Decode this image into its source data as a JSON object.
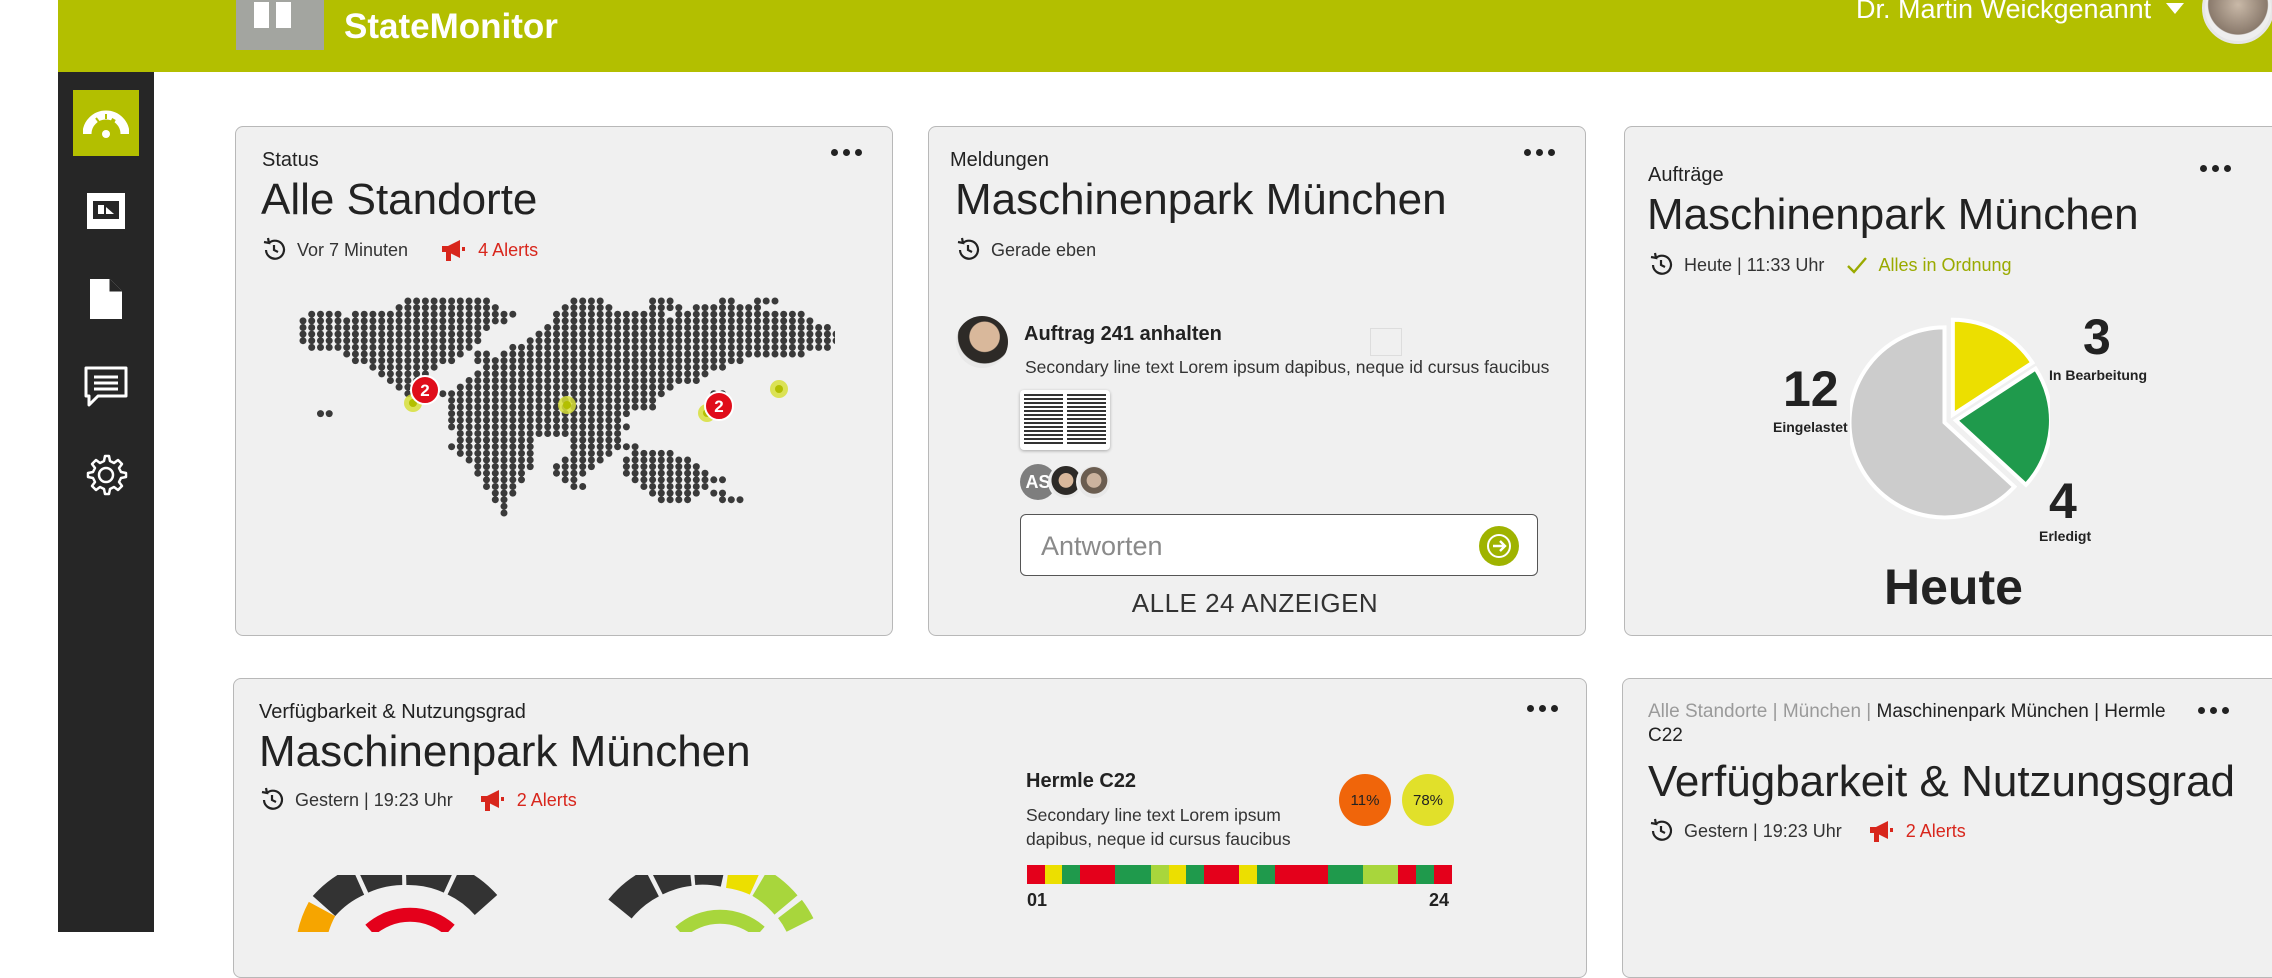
{
  "header": {
    "app_title": "StateMonitor",
    "user_name": "Dr. Martin Weickgenannt",
    "brand_color": "#b3bf00"
  },
  "sidebar": {
    "items": [
      {
        "icon": "dashboard-gauge-icon",
        "active": true
      },
      {
        "icon": "machine-icon",
        "active": false
      },
      {
        "icon": "document-icon",
        "active": false
      },
      {
        "icon": "message-icon",
        "active": false
      },
      {
        "icon": "gear-icon",
        "active": false
      }
    ]
  },
  "status_card": {
    "eyebrow": "Status",
    "title": "Alle Standorte",
    "updated": "Vor 7 Minuten",
    "alerts": "4 Alerts",
    "markers": [
      {
        "count": "2",
        "region": "north-america"
      },
      {
        "count": "2",
        "region": "asia"
      }
    ]
  },
  "messages_card": {
    "eyebrow": "Meldungen",
    "title": "Maschinenpark München",
    "updated": "Gerade eben",
    "message": {
      "title": "Auftrag 241 anhalten",
      "text": "Secondary line text Lorem ipsum dapibus, neque id cursus faucibus"
    },
    "participant_initials": "AS",
    "reply_placeholder": "Antworten",
    "show_all": "ALLE 24 ANZEIGEN"
  },
  "orders_card": {
    "eyebrow": "Aufträge",
    "title": "Maschinenpark München",
    "updated": "Heute | 11:33 Uhr",
    "status_ok": "Alles in Ordnung",
    "period": "Heute",
    "segments": [
      {
        "label": "Eingelastet",
        "value": 12,
        "color": "#cccccc"
      },
      {
        "label": "In Bearbeitung",
        "value": 3,
        "color": "#ecdf00"
      },
      {
        "label": "Erledigt",
        "value": 4,
        "color": "#1f9a4c"
      }
    ],
    "value_labels": [
      "12",
      "3",
      "4"
    ]
  },
  "availability_card": {
    "eyebrow": "Verfügbarkeit & Nutzungsgrad",
    "title": "Maschinenpark München",
    "updated": "Gestern | 19:23 Uhr",
    "alerts": "2 Alerts",
    "machine": {
      "name": "Hermle C22",
      "text": "Secondary line text Lorem ipsum dapibus, neque id cursus faucibus",
      "kpi_a": "11%",
      "kpi_b": "78%",
      "kpi_a_color": "#f0650a",
      "kpi_b_color": "#e1e02a",
      "hours_start": "01",
      "hours_end": "24",
      "hour_colors": [
        "#e4001b",
        "#ecdf00",
        "#1f9a4c",
        "#e4001b",
        "#e4001b",
        "#1f9a4c",
        "#1f9a4c",
        "#a8d63c",
        "#ecdf00",
        "#1f9a4c",
        "#e4001b",
        "#e4001b",
        "#ecdf00",
        "#1f9a4c",
        "#e4001b",
        "#e4001b",
        "#e4001b",
        "#1f9a4c",
        "#1f9a4c",
        "#a8d63c",
        "#a8d63c",
        "#e4001b",
        "#1f9a4c",
        "#e4001b"
      ]
    }
  },
  "detail_card": {
    "breadcrumb_muted": "Alle Standorte | München |",
    "breadcrumb_current": "Maschinenpark München | Hermle C22",
    "title": "Verfügbarkeit & Nutzungsgrad",
    "updated": "Gestern | 19:23 Uhr",
    "alerts": "2 Alerts"
  }
}
